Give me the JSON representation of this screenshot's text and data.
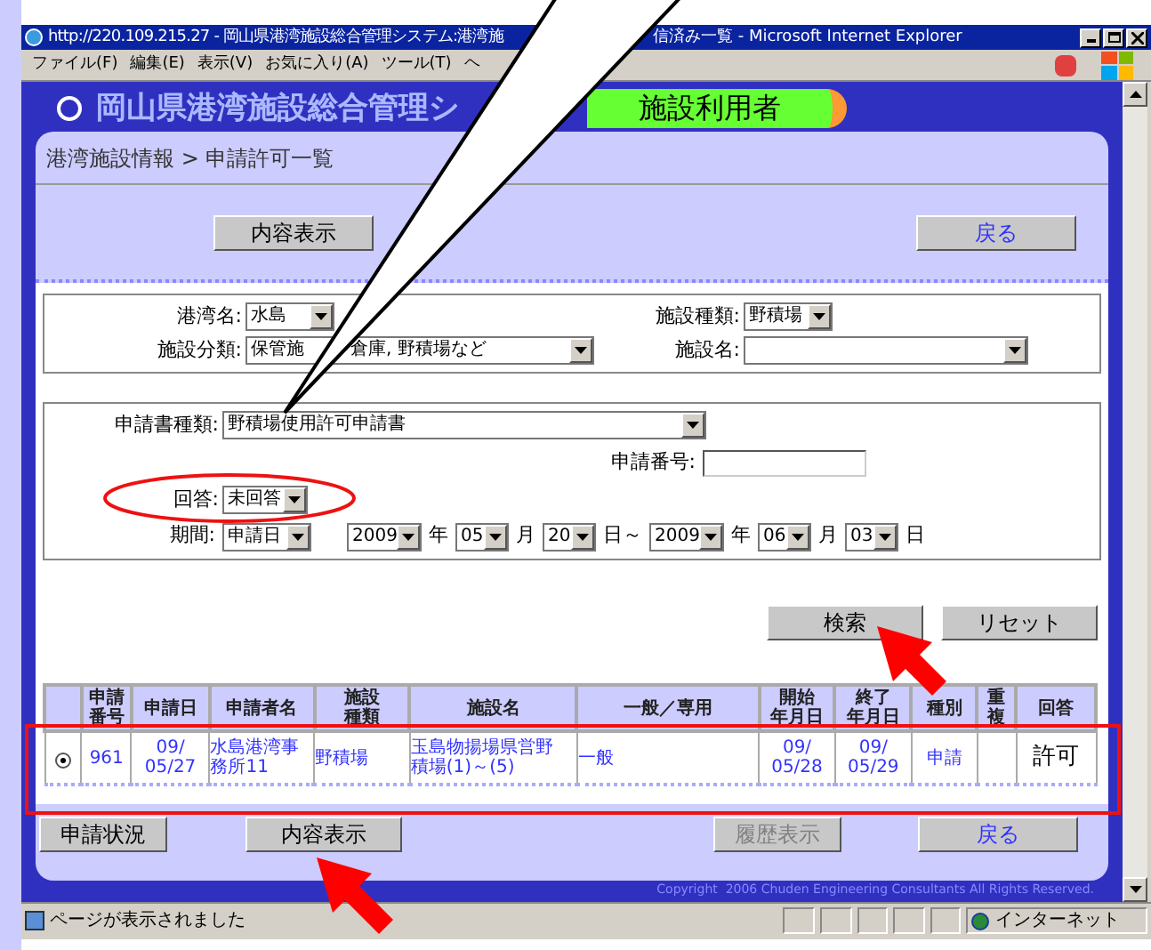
{
  "window": {
    "title_parts": [
      "http://220.109.215.27 - 岡山県港湾施設総合管理システム:港湾施",
      "信済み一覧 - Microsoft Internet Explorer"
    ]
  },
  "menu": [
    "ファイル(F)",
    "編集(E)",
    "表示(V)",
    "お気に入り(A)",
    "ツール(T)",
    "ヘ"
  ],
  "header": {
    "logo": "岡山県港湾施設総合管理シ",
    "role": "施設利用者"
  },
  "breadcrumb": "港湾施設情報 > 申請許可一覧",
  "top_buttons": [
    {
      "label": "内容表示",
      "kind": "normal"
    },
    {
      "label": "戻る",
      "kind": "link"
    }
  ],
  "filters": {
    "port": {
      "label": "港湾名:",
      "value": "水島"
    },
    "facility_type": {
      "label": "施設種類:",
      "value": "野積場"
    },
    "category": {
      "label": "施設分類:",
      "value_parts": [
        "保管施",
        "倉庫, 野積場など"
      ]
    },
    "facility_name": {
      "label": "施設名:"
    }
  },
  "filters2": {
    "form_type": {
      "label": "申請書種類:",
      "value": "野積場使用許可申請書"
    },
    "number": {
      "label": "申請番号:"
    },
    "answer": {
      "label": "回答:",
      "value": "未回答"
    },
    "period": {
      "label": "期間:",
      "basis": "申請日",
      "from": [
        "2009",
        "年",
        "05",
        "月",
        "20",
        "日～"
      ],
      "to": [
        "2009",
        "年",
        "06",
        "月",
        "03",
        "日"
      ]
    }
  },
  "search_buttons": [
    "検索",
    "リセット"
  ],
  "table": {
    "columns": [
      {
        "lines": [
          "申請",
          "番号"
        ]
      },
      "申請日",
      "申請者名",
      {
        "lines": [
          "施設",
          "種類"
        ]
      },
      "施設名",
      "一般／専用",
      {
        "lines": [
          "開始",
          "年月日"
        ]
      },
      {
        "lines": [
          "終了",
          "年月日"
        ]
      },
      "種別",
      {
        "lines": [
          "重",
          "複"
        ]
      },
      "回答"
    ],
    "rows": [
      {
        "selected": true,
        "cells": [
          "961",
          {
            "lines": [
              "09/",
              "05/27"
            ]
          },
          {
            "lines": [
              "水島港湾事",
              "務所11"
            ]
          },
          "野積場",
          {
            "lines": [
              "玉島物揚場県営野",
              "積場(1)～(5)"
            ]
          },
          "一般",
          {
            "lines": [
              "09/",
              "05/28"
            ]
          },
          {
            "lines": [
              "09/",
              "05/29"
            ]
          },
          "申請",
          "",
          "許可"
        ]
      }
    ]
  },
  "bottom_buttons": [
    {
      "label": "申請状況",
      "kind": "normal",
      "disabled": false
    },
    {
      "label": "内容表示",
      "kind": "normal",
      "disabled": false
    },
    {
      "label": "履歴表示",
      "kind": "normal",
      "disabled": true
    },
    {
      "label": "戻る",
      "kind": "link",
      "disabled": false
    }
  ],
  "copyright": "Copyright  2006 Chuden Engineering Consultants All Rights Reserved.",
  "status_bar": {
    "message": "ページが表示されました",
    "zone": "インターネット"
  }
}
